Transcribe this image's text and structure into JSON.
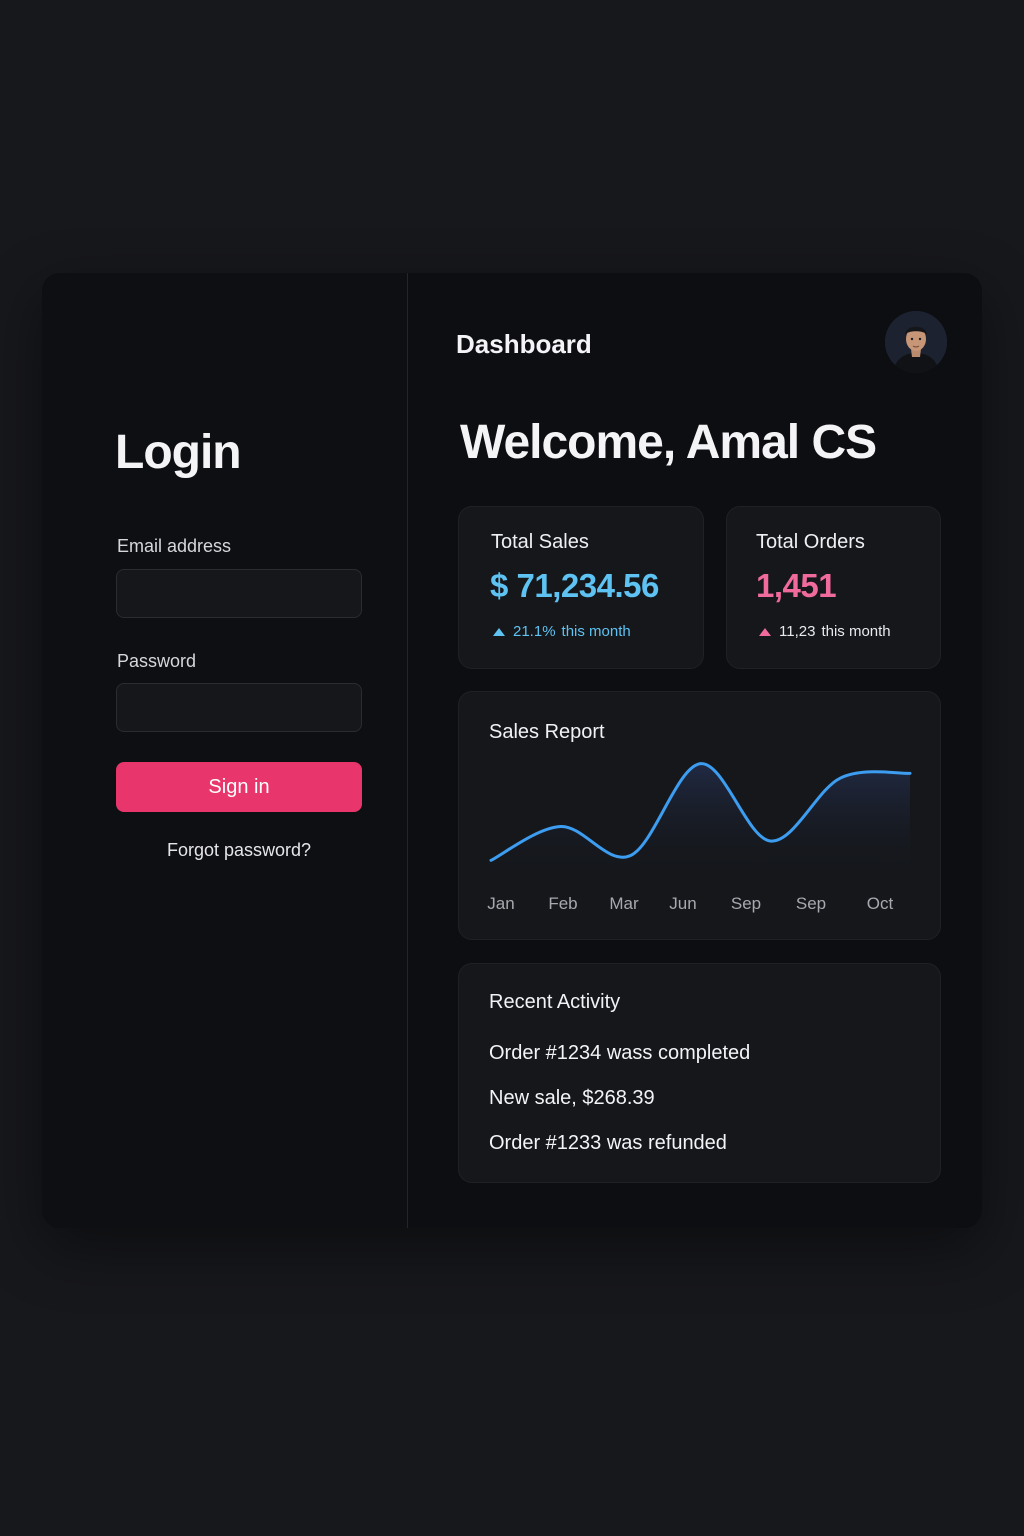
{
  "login": {
    "title": "Login",
    "email_label": "Email address",
    "email_value": "",
    "password_label": "Password",
    "password_value": "",
    "sign_in_label": "Sign in",
    "forgot_label": "Forgot password?"
  },
  "dashboard": {
    "title": "Dashboard",
    "welcome": "Welcome, Amal CS",
    "avatar_icon": "user-avatar",
    "stats": [
      {
        "label": "Total Sales",
        "value": "$ 71,234.56",
        "change": "21.1%",
        "period": "this month",
        "color": "#5ec2f2",
        "change_icon": "triangle-up-icon"
      },
      {
        "label": "Total Orders",
        "value": "1,451",
        "change": "11,23",
        "period": "this month",
        "color": "#f06b9b",
        "change_icon": "triangle-up-icon"
      }
    ],
    "recent_activity": {
      "title": "Recent Activity",
      "items": [
        "Order #1234 wass completed",
        "New sale, $268.39",
        "Order #1233 was refunded"
      ]
    }
  },
  "chart_data": {
    "type": "line",
    "title": "Sales Report",
    "categories": [
      "Jan",
      "Feb",
      "Mar",
      "Jun",
      "Sep",
      "Sep",
      "Oct"
    ],
    "values": [
      10,
      45,
      15,
      110,
      30,
      95,
      100
    ],
    "ylim": [
      0,
      120
    ],
    "line_color": "#3d9df0",
    "grid": false,
    "legend": "none"
  }
}
